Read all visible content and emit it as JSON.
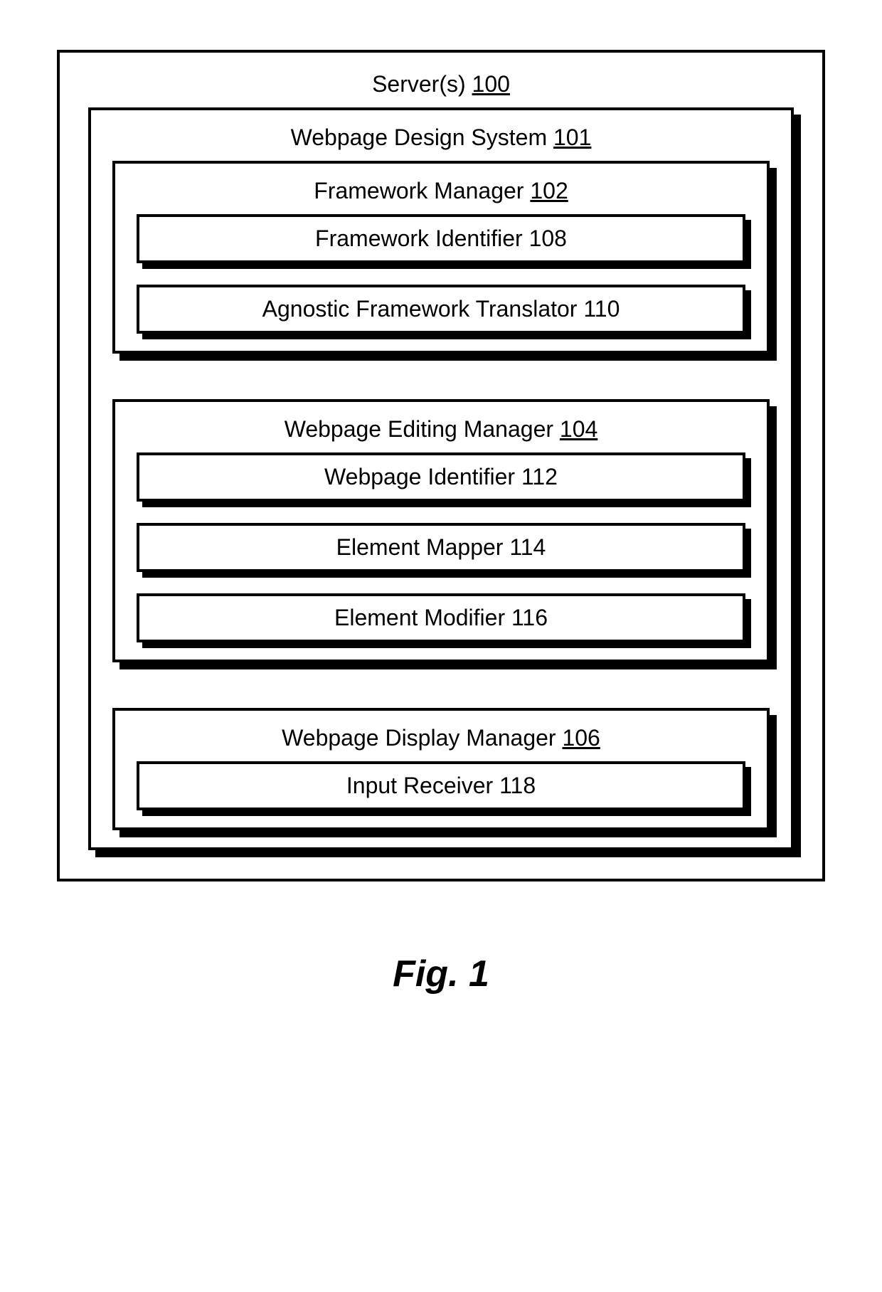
{
  "figure_caption": "Fig. 1",
  "server": {
    "label": "Server(s)",
    "num": "100"
  },
  "system": {
    "label": "Webpage Design System",
    "num": "101"
  },
  "framework_manager": {
    "label": "Framework Manager",
    "num": "102",
    "children": [
      {
        "label": "Framework Identifier",
        "num": "108"
      },
      {
        "label": "Agnostic Framework Translator",
        "num": "110"
      }
    ]
  },
  "editing_manager": {
    "label": "Webpage Editing Manager",
    "num": "104",
    "children": [
      {
        "label": "Webpage Identifier",
        "num": "112"
      },
      {
        "label": "Element Mapper",
        "num": "114"
      },
      {
        "label": "Element Modifier",
        "num": "116"
      }
    ]
  },
  "display_manager": {
    "label": "Webpage Display Manager",
    "num": "106",
    "children": [
      {
        "label": "Input Receiver",
        "num": "118"
      }
    ]
  }
}
